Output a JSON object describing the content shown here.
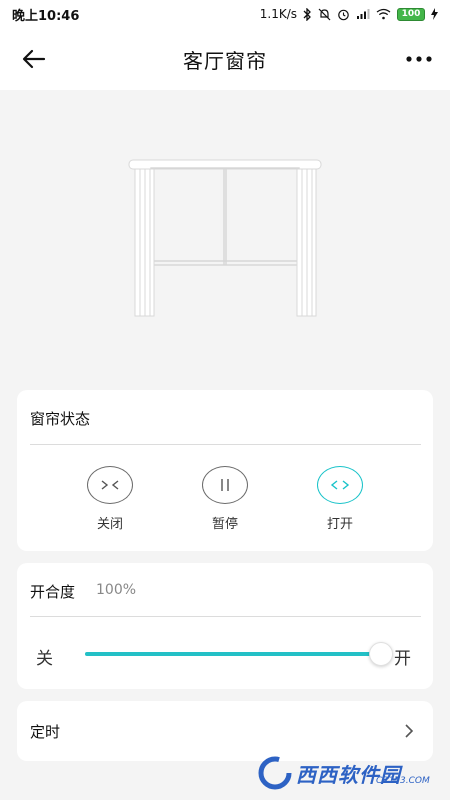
{
  "status_bar": {
    "time": "晚上10:46",
    "network_speed": "1.1K/s",
    "battery": "100"
  },
  "header": {
    "title": "客厅窗帘",
    "back_icon": "arrow-left-icon",
    "more_icon": "more-dots-icon"
  },
  "curtain_state": {
    "title": "窗帘状态",
    "controls": [
      {
        "label": "关闭",
        "icon": "close-curtain-icon",
        "active": false
      },
      {
        "label": "暂停",
        "icon": "pause-icon",
        "active": false
      },
      {
        "label": "打开",
        "icon": "open-curtain-icon",
        "active": true
      }
    ]
  },
  "openness": {
    "title": "开合度",
    "value_text": "100%",
    "value": 100,
    "min_label": "关",
    "max_label": "开"
  },
  "timer": {
    "title": "定时"
  },
  "watermark": {
    "text": "西西软件园",
    "site": "CR173.COM"
  },
  "colors": {
    "accent": "#23c0c6",
    "card_bg": "#ffffff",
    "page_bg": "#f4f4f4"
  }
}
